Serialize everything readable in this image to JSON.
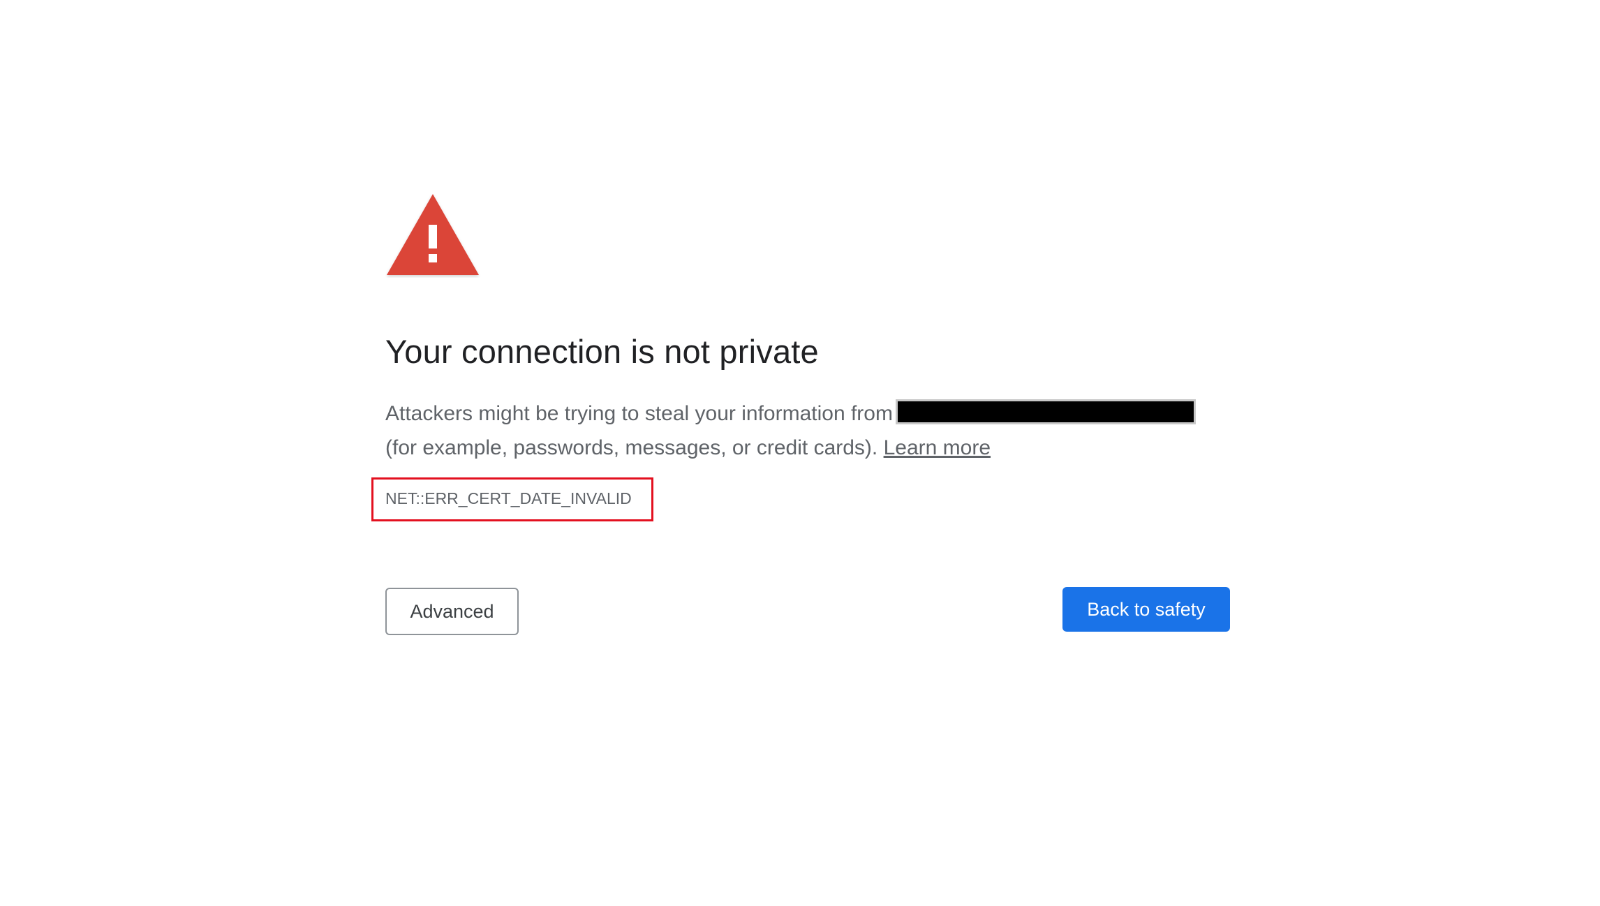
{
  "icon": {
    "name": "warning-triangle-icon",
    "color": "#db4437"
  },
  "title": "Your connection is not private",
  "description": {
    "text_before": "Attackers might be trying to steal your information from",
    "redacted_host": "",
    "text_after": "(for example, passwords, messages, or credit cards).",
    "learn_more_label": "Learn more"
  },
  "error_code": "NET::ERR_CERT_DATE_INVALID",
  "buttons": {
    "advanced_label": "Advanced",
    "back_label": "Back to safety"
  },
  "colors": {
    "primary_blue": "#1a73e8",
    "highlight_red": "#e3101f"
  }
}
